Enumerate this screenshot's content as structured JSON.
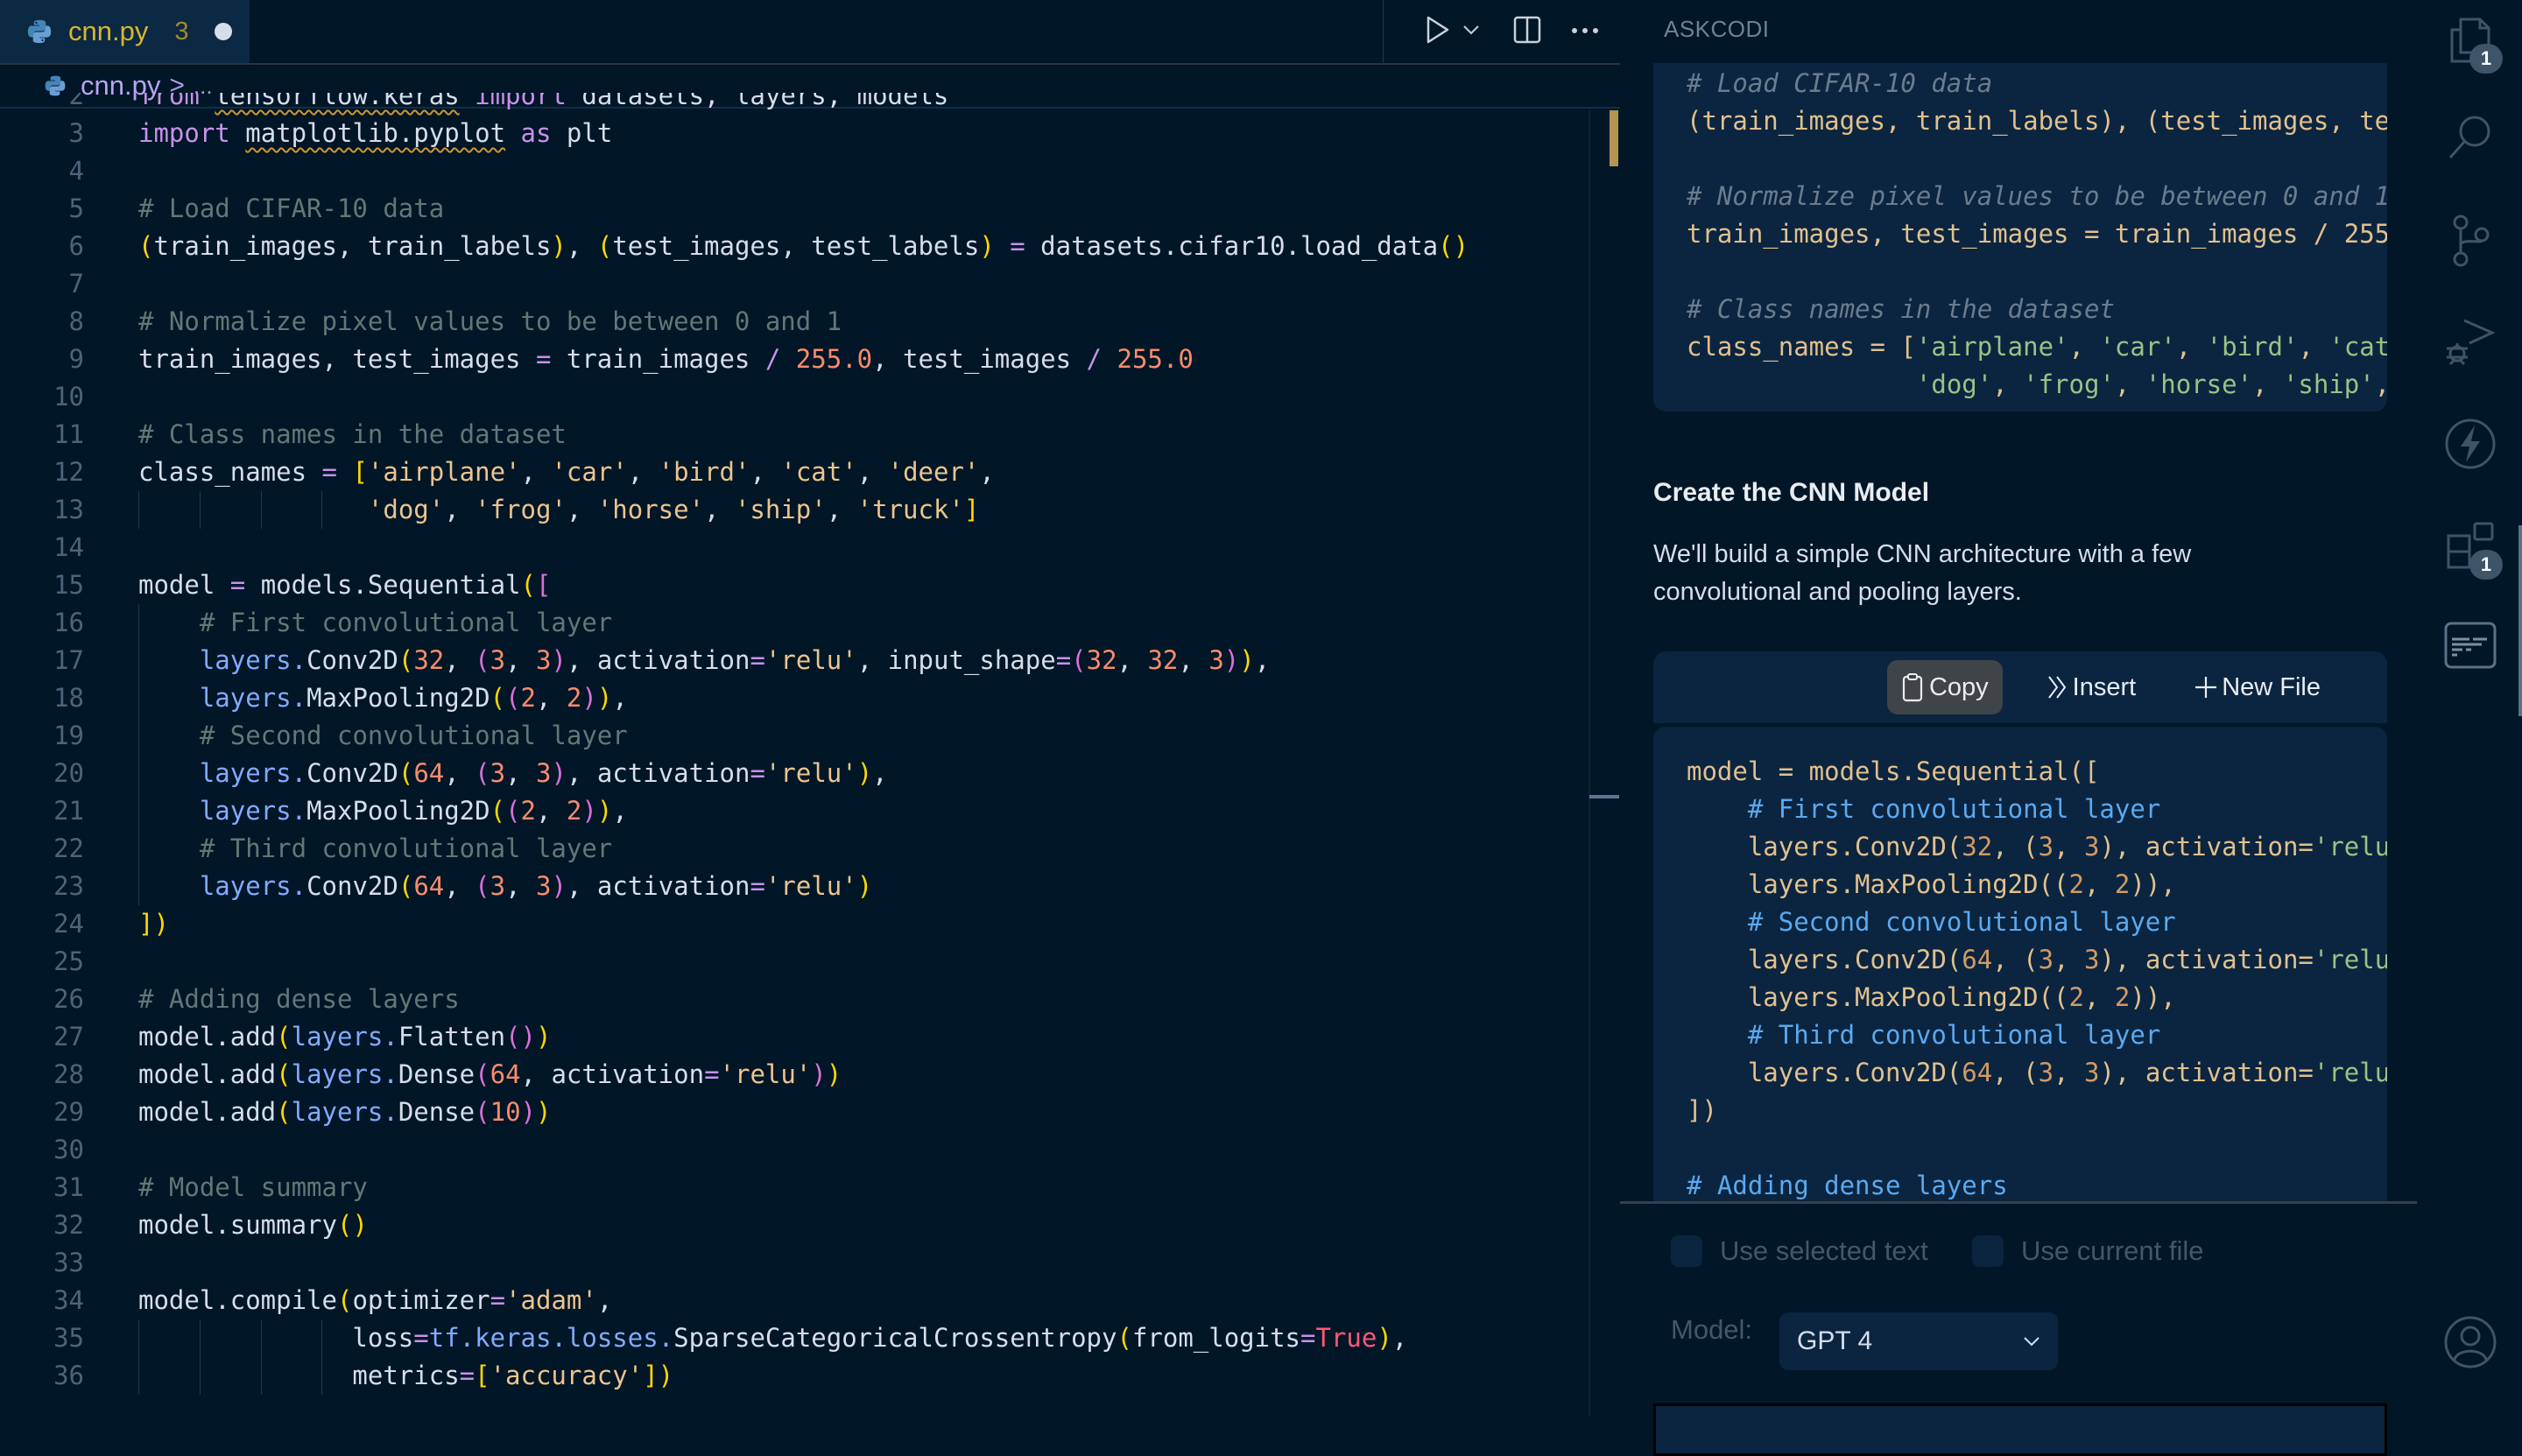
{
  "editor": {
    "tab": {
      "filename": "cnn.py",
      "problems_count": "3",
      "unsaved": true
    },
    "actions": [
      "run-python-file",
      "run-dropdown",
      "split-editor",
      "more-actions"
    ],
    "breadcrumb": {
      "file": "cnn.py",
      "separator": ">",
      "more": "..."
    },
    "lines": [
      {
        "n": "2",
        "text": "from tensorflow.keras import datasets, layers, models"
      },
      {
        "n": "3",
        "text": "import matplotlib.pyplot as plt"
      },
      {
        "n": "4",
        "text": ""
      },
      {
        "n": "5",
        "text": "# Load CIFAR-10 data"
      },
      {
        "n": "6",
        "text": "(train_images, train_labels), (test_images, test_labels) = datasets.cifar10.load_data()"
      },
      {
        "n": "7",
        "text": ""
      },
      {
        "n": "8",
        "text": "# Normalize pixel values to be between 0 and 1"
      },
      {
        "n": "9",
        "text": "train_images, test_images = train_images / 255.0, test_images / 255.0"
      },
      {
        "n": "10",
        "text": ""
      },
      {
        "n": "11",
        "text": "# Class names in the dataset"
      },
      {
        "n": "12",
        "text": "class_names = ['airplane', 'car', 'bird', 'cat', 'deer',"
      },
      {
        "n": "13",
        "text": "               'dog', 'frog', 'horse', 'ship', 'truck']"
      },
      {
        "n": "14",
        "text": ""
      },
      {
        "n": "15",
        "text": "model = models.Sequential(["
      },
      {
        "n": "16",
        "text": "    # First convolutional layer"
      },
      {
        "n": "17",
        "text": "    layers.Conv2D(32, (3, 3), activation='relu', input_shape=(32, 32, 3)),"
      },
      {
        "n": "18",
        "text": "    layers.MaxPooling2D((2, 2)),"
      },
      {
        "n": "19",
        "text": "    # Second convolutional layer"
      },
      {
        "n": "20",
        "text": "    layers.Conv2D(64, (3, 3), activation='relu'),"
      },
      {
        "n": "21",
        "text": "    layers.MaxPooling2D((2, 2)),"
      },
      {
        "n": "22",
        "text": "    # Third convolutional layer"
      },
      {
        "n": "23",
        "text": "    layers.Conv2D(64, (3, 3), activation='relu')"
      },
      {
        "n": "24",
        "text": "])"
      },
      {
        "n": "25",
        "text": ""
      },
      {
        "n": "26",
        "text": "# Adding dense layers"
      },
      {
        "n": "27",
        "text": "model.add(layers.Flatten())"
      },
      {
        "n": "28",
        "text": "model.add(layers.Dense(64, activation='relu'))"
      },
      {
        "n": "29",
        "text": "model.add(layers.Dense(10))"
      },
      {
        "n": "30",
        "text": ""
      },
      {
        "n": "31",
        "text": "# Model summary"
      },
      {
        "n": "32",
        "text": "model.summary()"
      },
      {
        "n": "33",
        "text": ""
      },
      {
        "n": "34",
        "text": "model.compile(optimizer='adam',"
      },
      {
        "n": "35",
        "text": "              loss=tf.keras.losses.SparseCategoricalCrossentropy(from_logits=True),"
      },
      {
        "n": "36",
        "text": "              metrics=['accuracy'])"
      }
    ]
  },
  "panel": {
    "title": "ASKCODI",
    "code_block_1": [
      "# Load CIFAR-10 data",
      "(train_images, train_labels), (test_images, te",
      "",
      "# Normalize pixel values to be between 0 and 1",
      "train_images, test_images = train_images / 255",
      "",
      "# Class names in the dataset",
      "class_names = ['airplane', 'car', 'bird', 'cat",
      "               'dog', 'frog', 'horse', 'ship',"
    ],
    "heading": "Create the CNN Model",
    "description": "We'll build a simple CNN architecture with a few convolutional and pooling layers.",
    "code_toolbar": {
      "copy": "Copy",
      "insert": "Insert",
      "new_file": "New File"
    },
    "code_block_2": [
      "model = models.Sequential([",
      "    # First convolutional layer",
      "    layers.Conv2D(32, (3, 3), activation='relu",
      "    layers.MaxPooling2D((2, 2)),",
      "    # Second convolutional layer",
      "    layers.Conv2D(64, (3, 3), activation='relu",
      "    layers.MaxPooling2D((2, 2)),",
      "    # Third convolutional layer",
      "    layers.Conv2D(64, (3, 3), activation='relu",
      "])",
      "",
      "# Adding dense layers"
    ],
    "options": {
      "use_selected_text": "Use selected text",
      "use_current_file": "Use current file",
      "use_selected_checked": false,
      "use_current_checked": false
    },
    "model_label": "Model:",
    "model_value": "GPT 4",
    "chat_input_placeholder": ""
  },
  "activity_bar": {
    "items": [
      {
        "name": "explorer",
        "badge": "1"
      },
      {
        "name": "search",
        "badge": null
      },
      {
        "name": "source-control",
        "badge": null
      },
      {
        "name": "run-and-debug",
        "badge": null
      },
      {
        "name": "askcodi",
        "badge": null
      },
      {
        "name": "extensions",
        "badge": "1"
      },
      {
        "name": "panel-view",
        "badge": null
      }
    ],
    "account": "accounts"
  },
  "colors": {
    "background": "#011627",
    "tab_active": "#0b2942",
    "tab_label": "#d7b52e",
    "comment": "#637777",
    "keyword": "#c792ea",
    "string": "#ecc48d",
    "number": "#f78c6c",
    "function": "#82aaff",
    "code_block_bg": "#0b2540"
  }
}
